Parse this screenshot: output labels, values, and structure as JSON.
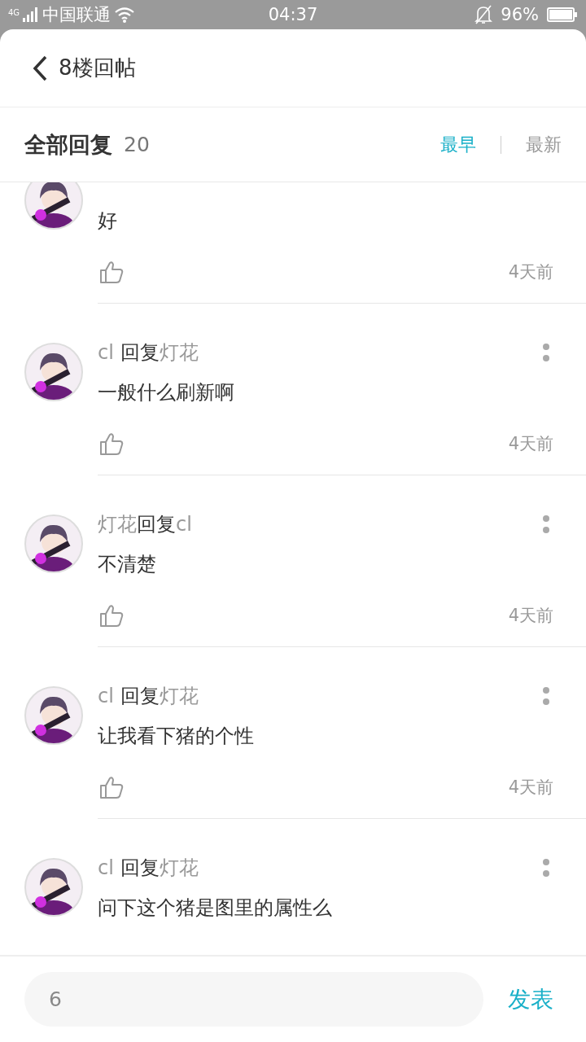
{
  "status_bar": {
    "network": "4G",
    "carrier": "中国联通",
    "time": "04:37",
    "battery": "96%"
  },
  "header": {
    "title": "8楼回帖"
  },
  "replies_header": {
    "title": "全部回复",
    "count": "20",
    "sorts": [
      {
        "label": "最早",
        "selected": true
      },
      {
        "label": "最新",
        "selected": false
      }
    ]
  },
  "replies": [
    {
      "content": "好",
      "time": "4天前"
    },
    {
      "author": "cl ",
      "action": "回复",
      "target": "灯花",
      "content": "一般什么刷新啊",
      "time": "4天前"
    },
    {
      "author": "灯花",
      "action": "回复",
      "target": "cl",
      "content": "不清楚",
      "time": "4天前"
    },
    {
      "author": "cl ",
      "action": "回复",
      "target": "灯花",
      "content": "让我看下猪的个性",
      "time": "4天前"
    },
    {
      "author": "cl ",
      "action": "回复",
      "target": "灯花",
      "content": "问下这个猪是图里的属性么"
    }
  ],
  "composer": {
    "value": "6",
    "send": "发表"
  }
}
